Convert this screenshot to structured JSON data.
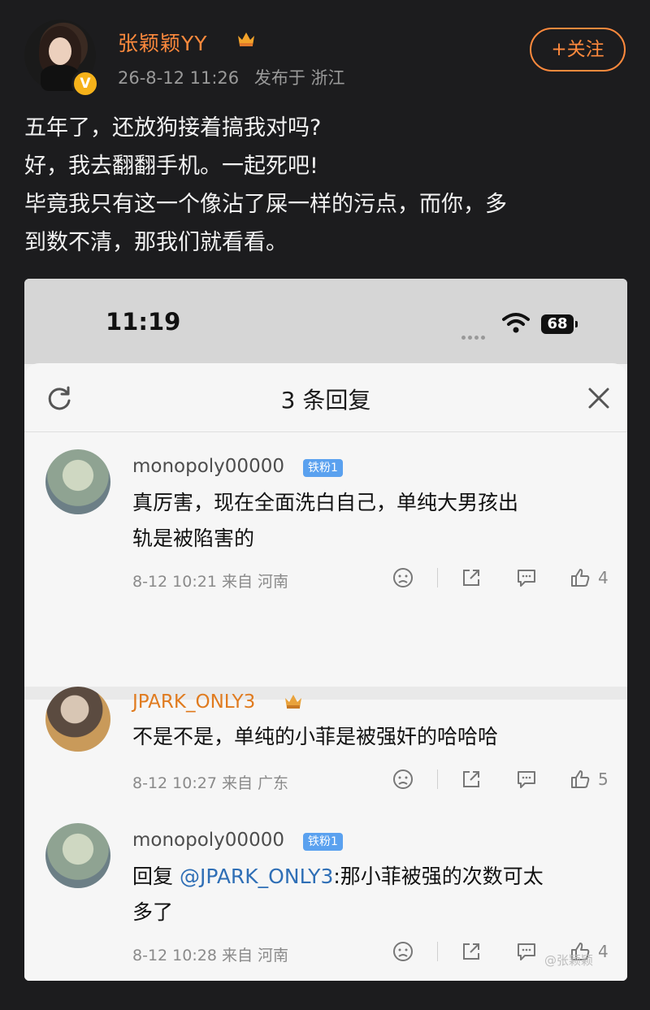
{
  "post": {
    "username": "张颖颖YY",
    "timestamp": "26-8-12 11:26",
    "location_label": "发布于 浙江",
    "verified_badge": "V",
    "follow_label": "+关注",
    "lines": [
      "五年了，还放狗接着搞我对吗?",
      "好，我去翻翻手机。一起死吧!",
      "毕竟我只有这一个像沾了屎一样的污点，而你，多",
      "到数不清，那我们就看看。"
    ]
  },
  "screenshot": {
    "status_bar": {
      "time": "11:19",
      "battery": "68"
    },
    "sheet": {
      "title": "3 条回复",
      "comments": [
        {
          "user": "monopoly00000",
          "badge": "铁粉1",
          "text_line1": "真厉害，现在全面洗白自己，单纯大男孩出",
          "text_line2": "轨是被陷害的",
          "meta": "8-12 10:21 来自 河南",
          "likes": "4"
        },
        {
          "user": "JPARK_ONLY3",
          "text_line1": "不是不是，单纯的小菲是被强奸的哈哈哈",
          "meta": "8-12 10:27 来自 广东",
          "likes": "5"
        },
        {
          "user": "monopoly00000",
          "badge": "铁粉1",
          "reply_prefix": "回复",
          "mention": "@JPARK_ONLY3",
          "text_line1": ":那小菲被强的次数可太",
          "text_line2": "多了",
          "meta": "8-12 10:28 来自 河南",
          "likes": "4"
        }
      ]
    },
    "watermark": "@张颖颖"
  },
  "colors": {
    "accent": "#ff8a3d",
    "link": "#2f6fb6",
    "fan_badge": "#5aa1ef"
  }
}
